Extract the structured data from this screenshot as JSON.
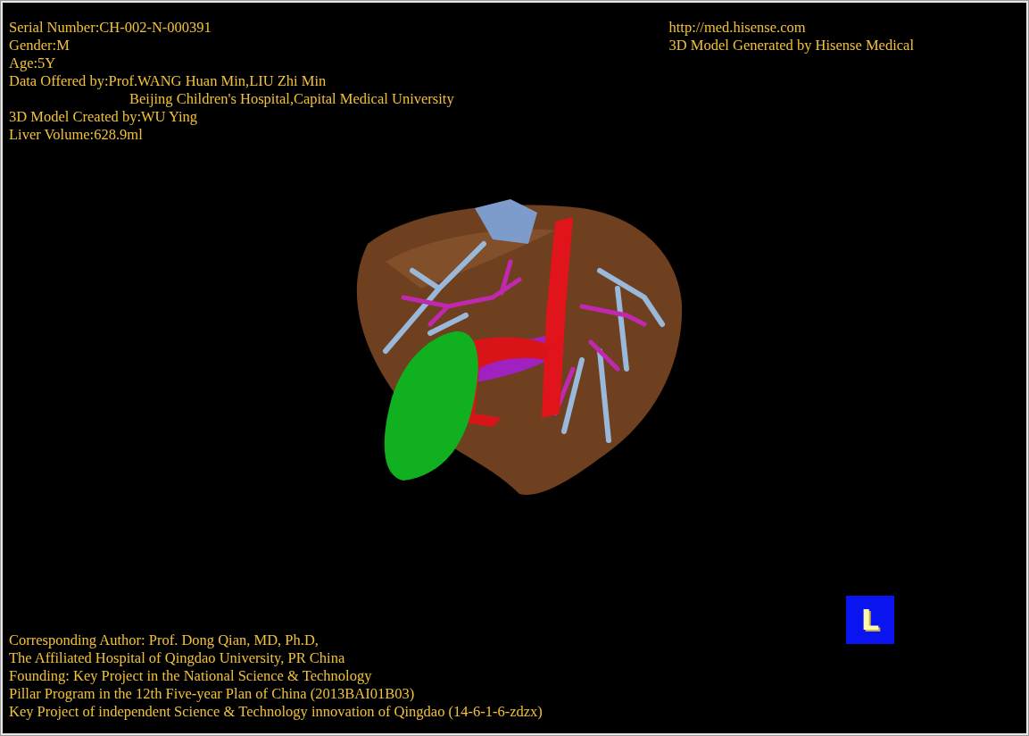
{
  "patient_info": [
    {
      "kind": "line",
      "text": "Serial Number:CH-002-N-000391"
    },
    {
      "kind": "line",
      "text": "Gender:M"
    },
    {
      "kind": "line",
      "text": "Age:5Y"
    },
    {
      "kind": "line",
      "text": "Data Offered by:Prof.WANG Huan Min,LIU Zhi Min"
    },
    {
      "kind": "continuation",
      "text": "Beijing Children's Hospital,Capital Medical University"
    },
    {
      "kind": "line",
      "text": "3D Model Created by:WU Ying"
    },
    {
      "kind": "line",
      "text": "Liver Volume:628.9ml"
    }
  ],
  "credits": [
    "http://med.hisense.com",
    "3D Model Generated by Hisense Medical"
  ],
  "acknowledgements": [
    "Corresponding Author: Prof. Dong Qian, MD, Ph.D,",
    "The Affiliated Hospital of Qingdao University, PR China",
    "Founding: Key Project in the National Science & Technology",
    "Pillar Program in the 12th Five-year Plan of China (2013BAI01B03)",
    "Key Project of independent Science & Technology innovation of Qingdao (14-6-1-6-zdzx)"
  ],
  "orientation_marker": "L"
}
